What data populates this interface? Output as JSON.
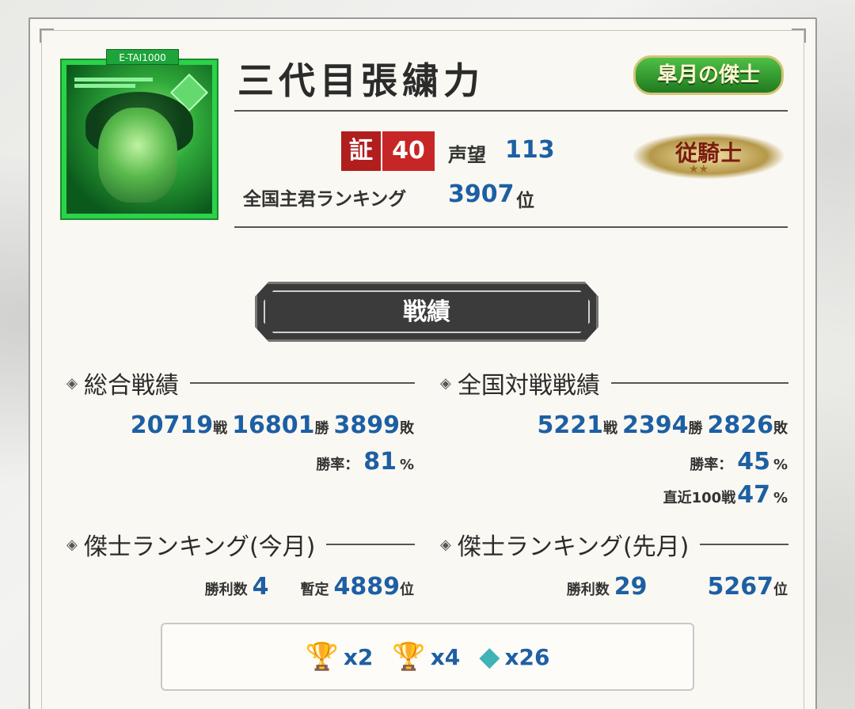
{
  "player": {
    "name": "三代目張繍力",
    "avatar_tag": "E-TAI1000",
    "title_badge": "皐月の傑士",
    "cert_kanji": "証",
    "cert_level": "40",
    "renown_label": "声望",
    "renown_value": "113",
    "ranking_label": "全国主君ランキング",
    "ranking_value": "3907",
    "ranking_unit": "位",
    "knight_rank": "従騎士",
    "knight_stars": "★★"
  },
  "banner": {
    "label": "戦績"
  },
  "overall": {
    "heading": "総合戦績",
    "battles": "20719",
    "battles_unit": "戦",
    "wins": "16801",
    "wins_unit": "勝",
    "losses": "3899",
    "losses_unit": "敗",
    "rate_label": "勝率：",
    "rate": "81",
    "rate_unit": "%"
  },
  "national": {
    "heading": "全国対戦戦績",
    "battles": "5221",
    "battles_unit": "戦",
    "wins": "2394",
    "wins_unit": "勝",
    "losses": "2826",
    "losses_unit": "敗",
    "rate_label": "勝率：",
    "rate": "45",
    "rate_unit": "%",
    "recent_label": "直近100戦",
    "recent_rate": "47",
    "recent_unit": "%"
  },
  "ranking_this_month": {
    "heading": "傑士ランキング(今月)",
    "wins_label": "勝利数",
    "wins": "4",
    "provisional_label": "暫定",
    "rank": "4889",
    "rank_unit": "位"
  },
  "ranking_last_month": {
    "heading": "傑士ランキング(先月)",
    "wins_label": "勝利数",
    "wins": "29",
    "rank": "5267",
    "rank_unit": "位"
  },
  "trophies": [
    {
      "icon": "silver-trophy-icon",
      "count": "x2"
    },
    {
      "icon": "bronze-trophy-icon",
      "count": "x4"
    },
    {
      "icon": "medal-icon",
      "count": "x26"
    }
  ],
  "colors": {
    "accent_blue": "#1d5fa3",
    "cert_red": "#c72626",
    "avatar_green": "#2bd24a"
  }
}
